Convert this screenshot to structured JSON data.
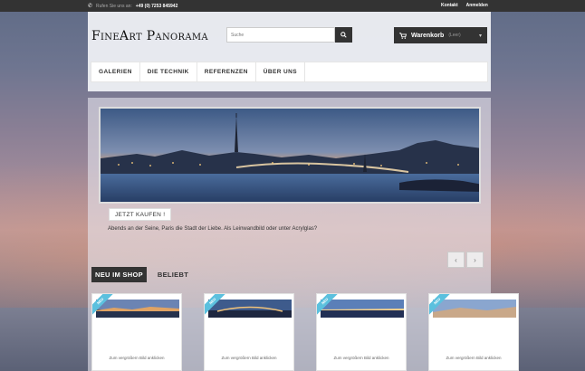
{
  "topbar": {
    "phone_label": "Rufen Sie uns an:",
    "phone_number": "+49 (0) 7253 845942",
    "links": [
      "Kontakt",
      "Anmelden"
    ]
  },
  "header": {
    "logo": "FineArt Panorama",
    "search_placeholder": "Suche",
    "cart_label": "Warenkorb",
    "cart_count": "(Leer)"
  },
  "nav": {
    "items": [
      "GALERIEN",
      "DIE TECHNIK",
      "REFERENZEN",
      "ÜBER UNS"
    ]
  },
  "slider": {
    "button": "JETZT KAUFEN !",
    "caption": "Abends an der Seine,  Paris die Stadt der Liebe.  Als Leinwandbild oder unter Acrylglas?",
    "prev": "‹",
    "next": "›"
  },
  "tabs": {
    "active": "NEU IM SHOP",
    "other": "BELIEBT"
  },
  "products": [
    {
      "ribbon": "NEU",
      "zoom": "Zum vergrößern Bild anklicken"
    },
    {
      "ribbon": "NEU",
      "zoom": "Zum vergrößern Bild anklicken"
    },
    {
      "ribbon": "NEU",
      "zoom": "Zum vergrößern Bild anklicken"
    },
    {
      "ribbon": "NEU",
      "zoom": "Zum vergrößern Bild anklicken"
    }
  ],
  "colors": {
    "dark": "#333333",
    "ribbon": "#5bc0de"
  }
}
